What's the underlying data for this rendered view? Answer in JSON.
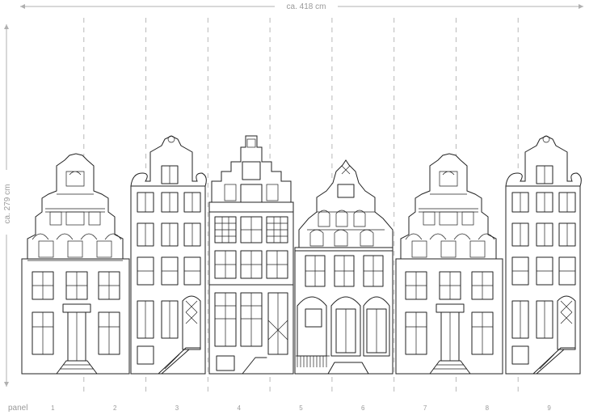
{
  "dimensions": {
    "width_label": "ca. 418 cm",
    "height_label": "ca. 279 cm"
  },
  "panels": {
    "label": "panel",
    "numbers": [
      "1",
      "2",
      "3",
      "4",
      "5",
      "6",
      "7",
      "8",
      "9"
    ]
  },
  "artwork": {
    "buildings": [
      "gable-house",
      "neck-gable-house",
      "step-gable-house",
      "ornate-gable-house",
      "gable-house",
      "neck-gable-house"
    ],
    "line_color": "#222222",
    "guide_color": "#b8b8b8"
  }
}
